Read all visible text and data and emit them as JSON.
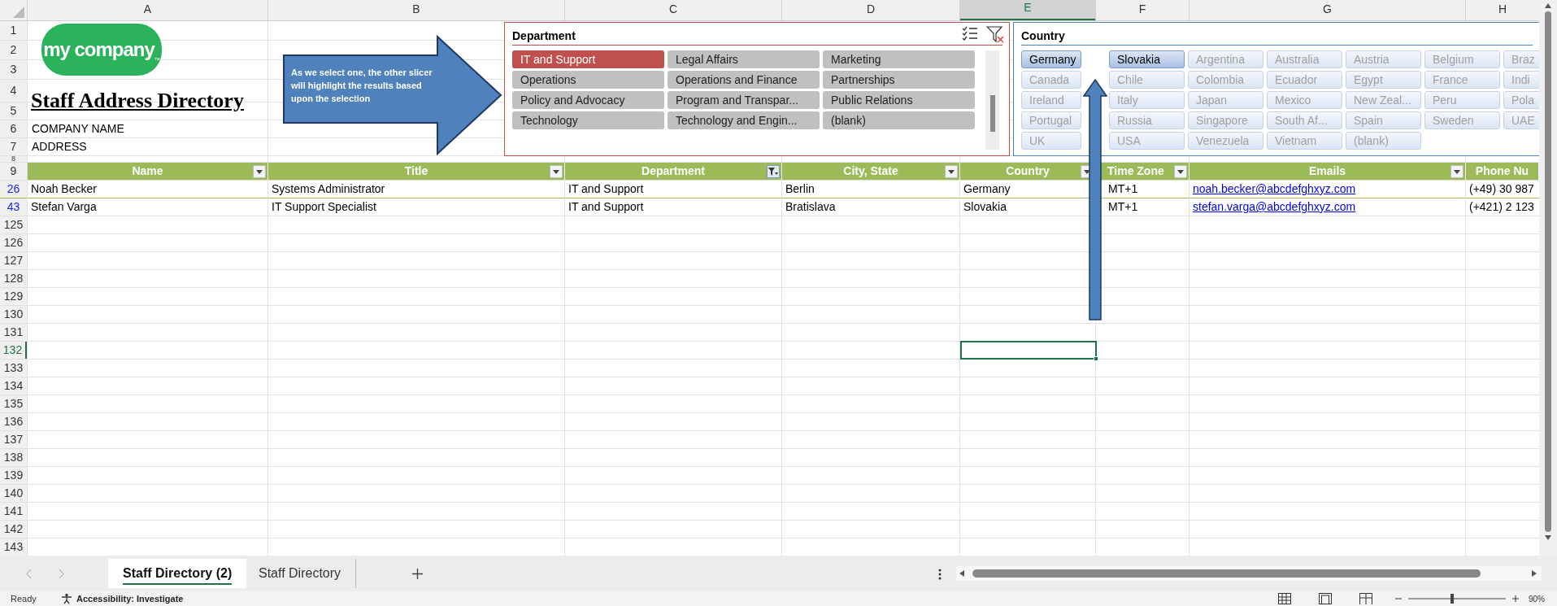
{
  "header_block": {
    "logo_text": "my company",
    "logo_mark": "™",
    "title": "Staff Address Directory",
    "company_name": "COMPANY NAME",
    "address": "ADDRESS"
  },
  "column_headers": [
    {
      "label": "A",
      "selected": false
    },
    {
      "label": "B",
      "selected": false
    },
    {
      "label": "C",
      "selected": false
    },
    {
      "label": "D",
      "selected": false
    },
    {
      "label": "E",
      "selected": true
    },
    {
      "label": "F",
      "selected": false
    },
    {
      "label": "G",
      "selected": false
    },
    {
      "label": "H",
      "selected": false
    }
  ],
  "top_row_numbers": [
    "1",
    "2",
    "3",
    "4",
    "5",
    "6",
    "7",
    "8"
  ],
  "table": {
    "header_row_number": "9",
    "columns": [
      {
        "label": "Name",
        "filtered": false,
        "kind": "text"
      },
      {
        "label": "Title",
        "filtered": false,
        "kind": "text"
      },
      {
        "label": "Department",
        "filtered": true,
        "kind": "text"
      },
      {
        "label": "City, State",
        "filtered": false,
        "kind": "text"
      },
      {
        "label": "Country",
        "filtered": false,
        "kind": "text"
      },
      {
        "label": "Time Zone",
        "filtered": false,
        "kind": "text"
      },
      {
        "label": "Emails",
        "filtered": false,
        "kind": "link"
      },
      {
        "label": "Phone Nu",
        "kind": "text"
      }
    ],
    "rows": [
      {
        "row_number": "26",
        "cells": [
          "Noah Becker",
          "Systems Administrator",
          "IT and Support",
          "Berlin",
          "Germany",
          "MT+1",
          "noah.becker@abcdefghxyz.com",
          "(+49) 30 987"
        ]
      },
      {
        "row_number": "43",
        "cells": [
          "Stefan Varga",
          "IT Support Specialist",
          "IT and Support",
          "Bratislava",
          "Slovakia",
          "MT+1",
          "stefan.varga@abcdefghxyz.com",
          "(+421) 2 123"
        ]
      }
    ]
  },
  "empty_rows": [
    {
      "row_number": "125",
      "selected": false
    },
    {
      "row_number": "126",
      "selected": false
    },
    {
      "row_number": "127",
      "selected": false
    },
    {
      "row_number": "128",
      "selected": false
    },
    {
      "row_number": "129",
      "selected": false
    },
    {
      "row_number": "130",
      "selected": false
    },
    {
      "row_number": "131",
      "selected": false
    },
    {
      "row_number": "132",
      "selected": true
    },
    {
      "row_number": "133",
      "selected": false
    },
    {
      "row_number": "134",
      "selected": false
    },
    {
      "row_number": "135",
      "selected": false
    },
    {
      "row_number": "136",
      "selected": false
    },
    {
      "row_number": "137",
      "selected": false
    },
    {
      "row_number": "138",
      "selected": false
    },
    {
      "row_number": "139",
      "selected": false
    },
    {
      "row_number": "140",
      "selected": false
    },
    {
      "row_number": "141",
      "selected": false
    },
    {
      "row_number": "142",
      "selected": false
    },
    {
      "row_number": "143",
      "selected": false
    }
  ],
  "callout": {
    "text": "As we select one, the other slicer will highlight the results based upon the selection"
  },
  "slicers": [
    {
      "kind": "department",
      "title": "Department",
      "items": [
        {
          "label": "IT and Support",
          "selected": true
        },
        {
          "label": "Legal Affairs",
          "selected": false
        },
        {
          "label": "Marketing",
          "selected": false
        },
        {
          "label": "Operations",
          "selected": false
        },
        {
          "label": "Operations and Finance",
          "selected": false
        },
        {
          "label": "Partnerships",
          "selected": false
        },
        {
          "label": "Policy and Advocacy",
          "selected": false
        },
        {
          "label": "Program and Transpar...",
          "selected": false
        },
        {
          "label": "Public Relations",
          "selected": false
        },
        {
          "label": "Technology",
          "selected": false
        },
        {
          "label": "Technology and Engin...",
          "selected": false
        },
        {
          "label": "(blank)",
          "selected": false
        }
      ]
    },
    {
      "kind": "country",
      "title": "Country",
      "items": [
        {
          "label": "Germany",
          "selected": true
        },
        {
          "label": "Slovakia",
          "selected": true
        },
        {
          "label": "Argentina",
          "selected": false
        },
        {
          "label": "Australia",
          "selected": false
        },
        {
          "label": "Austria",
          "selected": false
        },
        {
          "label": "Belgium",
          "selected": false
        },
        {
          "label": "Braz",
          "selected": false
        },
        {
          "label": "Canada",
          "selected": false
        },
        {
          "label": "Chile",
          "selected": false
        },
        {
          "label": "Colombia",
          "selected": false
        },
        {
          "label": "Ecuador",
          "selected": false
        },
        {
          "label": "Egypt",
          "selected": false
        },
        {
          "label": "France",
          "selected": false
        },
        {
          "label": "Indi",
          "selected": false
        },
        {
          "label": "Ireland",
          "selected": false
        },
        {
          "label": "Italy",
          "selected": false
        },
        {
          "label": "Japan",
          "selected": false
        },
        {
          "label": "Mexico",
          "selected": false
        },
        {
          "label": "New Zeal...",
          "selected": false
        },
        {
          "label": "Peru",
          "selected": false
        },
        {
          "label": "Pola",
          "selected": false
        },
        {
          "label": "Portugal",
          "selected": false
        },
        {
          "label": "Russia",
          "selected": false
        },
        {
          "label": "Singapore",
          "selected": false
        },
        {
          "label": "South Af...",
          "selected": false
        },
        {
          "label": "Spain",
          "selected": false
        },
        {
          "label": "Sweden",
          "selected": false
        },
        {
          "label": "UAE",
          "selected": false
        },
        {
          "label": "UK",
          "selected": false
        },
        {
          "label": "USA",
          "selected": false
        },
        {
          "label": "Venezuela",
          "selected": false
        },
        {
          "label": "Vietnam",
          "selected": false
        },
        {
          "label": "(blank)",
          "selected": false
        }
      ]
    }
  ],
  "sheet_tabs": [
    {
      "label": "Staff Directory (2)",
      "selected": true
    },
    {
      "label": "Staff Directory",
      "selected": false
    }
  ],
  "status_bar": {
    "mode": "Ready",
    "accessibility": "Accessibility: Investigate",
    "zoom": "90%",
    "zoom_slider": {
      "level": 0.45
    }
  }
}
